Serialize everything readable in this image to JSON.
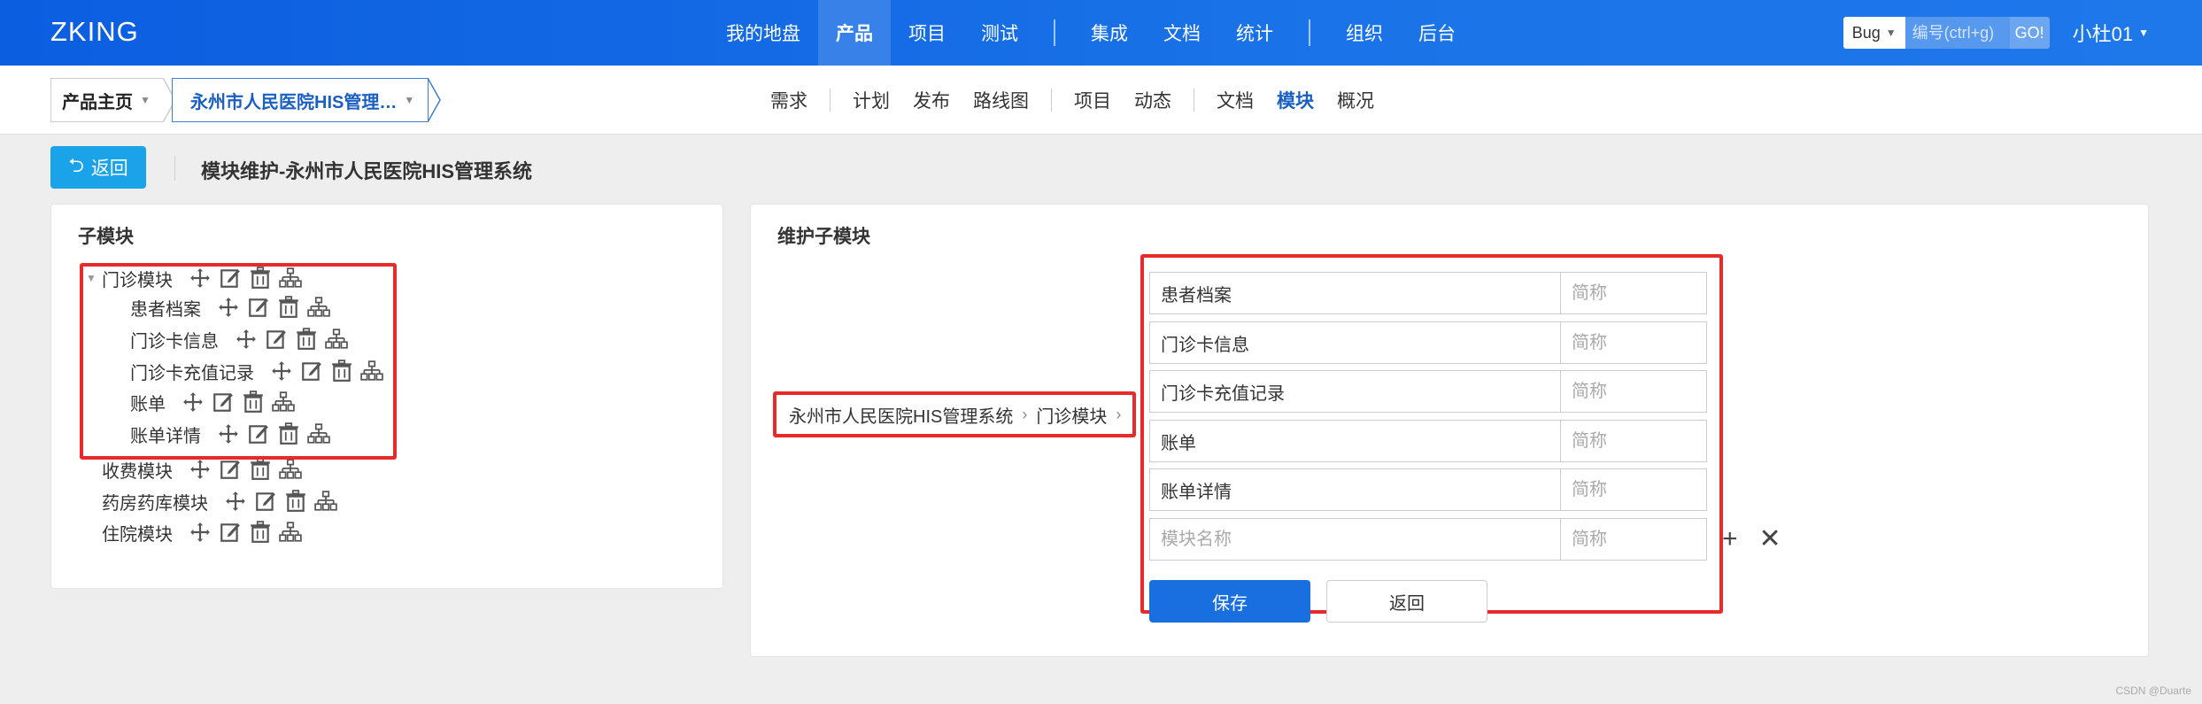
{
  "header": {
    "logo": "ZKING",
    "nav": [
      "我的地盘",
      "产品",
      "项目",
      "测试",
      "集成",
      "文档",
      "统计",
      "组织",
      "后台"
    ],
    "active_nav": "产品",
    "search_type": "Bug",
    "search_placeholder": "编号(ctrl+g)",
    "go_label": "GO!",
    "user": "小杜01"
  },
  "subbar": {
    "crumb_home": "产品主页",
    "crumb_product": "永州市人民医院HIS管理…",
    "nav": [
      "需求",
      "计划",
      "发布",
      "路线图",
      "项目",
      "动态",
      "文档",
      "模块",
      "概况"
    ],
    "active_nav": "模块"
  },
  "page": {
    "back_label": "返回",
    "title": "模块维护-永州市人民医院HIS管理系统"
  },
  "left_panel": {
    "title": "子模块",
    "tree": [
      {
        "label": "门诊模块",
        "level": 0,
        "expanded": true
      },
      {
        "label": "患者档案",
        "level": 1
      },
      {
        "label": "门诊卡信息",
        "level": 1
      },
      {
        "label": "门诊卡充值记录",
        "level": 1
      },
      {
        "label": "账单",
        "level": 1
      },
      {
        "label": "账单详情",
        "level": 1
      },
      {
        "label": "收费模块",
        "level": 0
      },
      {
        "label": "药房药库模块",
        "level": 0
      },
      {
        "label": "住院模块",
        "level": 0
      }
    ],
    "action_icons": [
      "move-icon",
      "edit-icon",
      "delete-icon",
      "submodule-icon"
    ]
  },
  "right_panel": {
    "title": "维护子模块",
    "path": [
      "永州市人民医院HIS管理系统",
      "门诊模块"
    ],
    "rows": [
      {
        "name": "患者档案",
        "short_placeholder": "简称"
      },
      {
        "name": "门诊卡信息",
        "short_placeholder": "简称"
      },
      {
        "name": "门诊卡充值记录",
        "short_placeholder": "简称"
      },
      {
        "name": "账单",
        "short_placeholder": "简称"
      },
      {
        "name": "账单详情",
        "short_placeholder": "简称"
      },
      {
        "name": "",
        "name_placeholder": "模块名称",
        "short_placeholder": "简称"
      }
    ],
    "add_icon": "+",
    "remove_icon": "✕",
    "save_label": "保存",
    "return_label": "返回"
  },
  "colors": {
    "header_blue": "#1a73e8",
    "active_blue": "#1a5fc4",
    "back_button": "#1aa3e8",
    "save_button": "#1a6fe0",
    "highlight_red": "#e82a2a"
  },
  "watermark": "CSDN @Duarte"
}
